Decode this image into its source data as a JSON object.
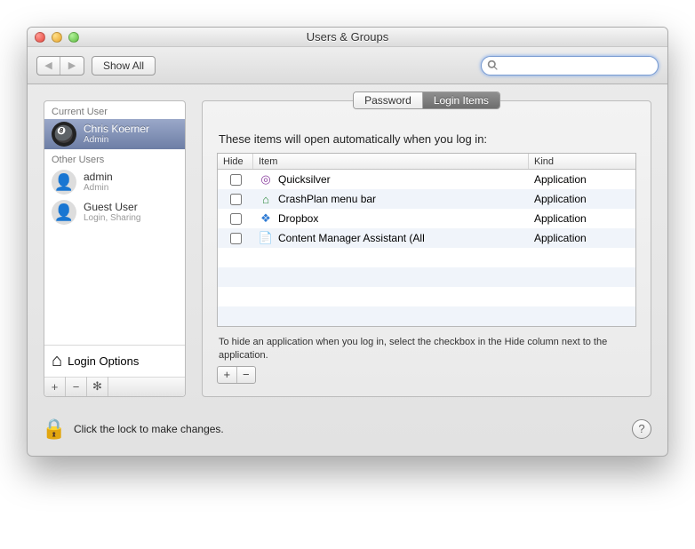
{
  "window": {
    "title": "Users & Groups"
  },
  "toolbar": {
    "show_all": "Show All",
    "search_placeholder": ""
  },
  "sidebar": {
    "current_label": "Current User",
    "other_label": "Other Users",
    "current": {
      "name": "Chris Koerner",
      "role": "Admin"
    },
    "others": [
      {
        "name": "admin",
        "role": "Admin"
      },
      {
        "name": "Guest User",
        "role": "Login, Sharing"
      }
    ],
    "login_options": "Login Options"
  },
  "tabs": {
    "password": "Password",
    "login_items": "Login Items"
  },
  "content": {
    "desc": "These items will open automatically when you log in:",
    "columns": {
      "hide": "Hide",
      "item": "Item",
      "kind": "Kind"
    },
    "rows": [
      {
        "hide": false,
        "item": "Quicksilver",
        "kind": "Application",
        "icon": "◎",
        "icon_color": "#8b3fa0"
      },
      {
        "hide": false,
        "item": "CrashPlan menu bar",
        "kind": "Application",
        "icon": "⌂",
        "icon_color": "#2e8b3d"
      },
      {
        "hide": false,
        "item": "Dropbox",
        "kind": "Application",
        "icon": "❖",
        "icon_color": "#2f7bd4"
      },
      {
        "hide": false,
        "item": "Content Manager Assistant (All",
        "kind": "Application",
        "icon": "📄",
        "icon_color": "#888"
      }
    ],
    "hint": "To hide an application when you log in, select the checkbox in the Hide column next to the application."
  },
  "bottom": {
    "lock_text": "Click the lock to make changes."
  }
}
